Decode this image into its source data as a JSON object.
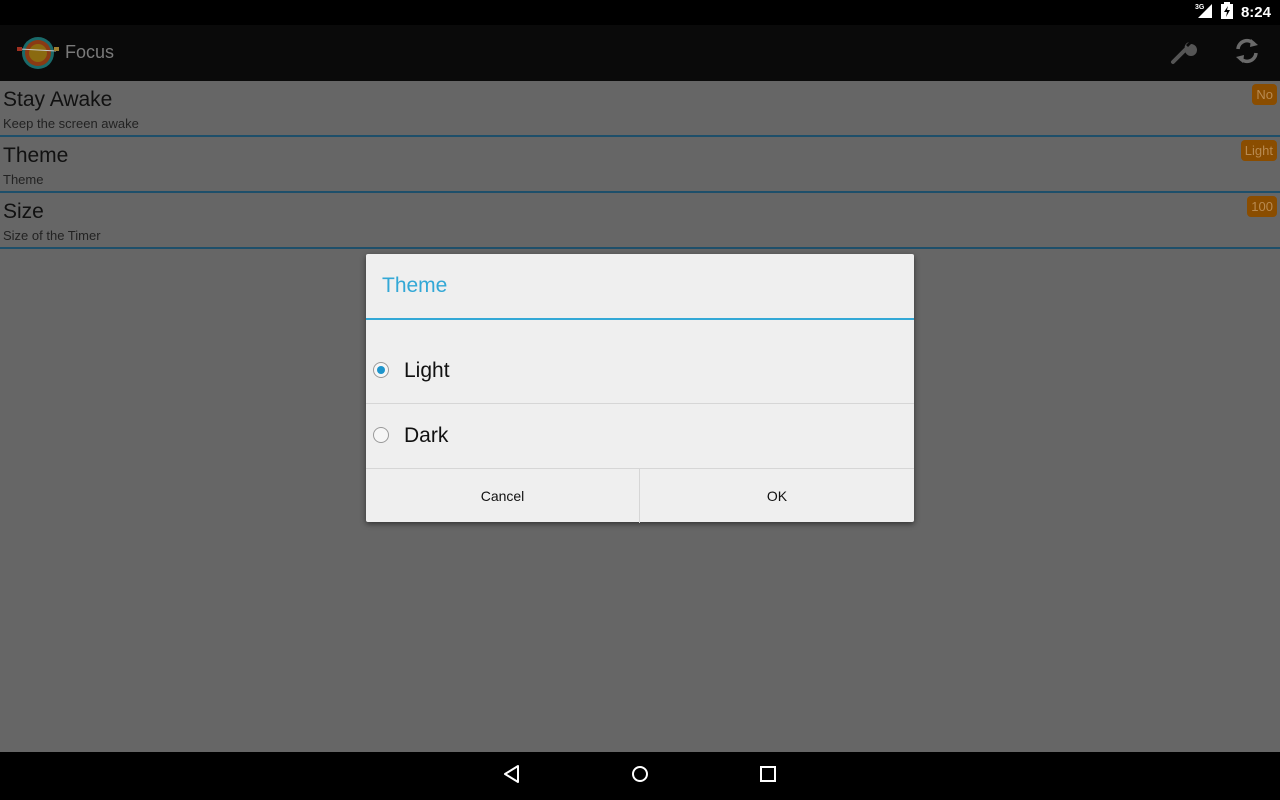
{
  "status_bar": {
    "network": "3G",
    "time": "8:24",
    "icons": [
      "signal-3g-icon",
      "battery-charging-icon"
    ]
  },
  "action_bar": {
    "title": "Focus",
    "icons": [
      "app-target-icon",
      "wrench-icon",
      "refresh-icon"
    ]
  },
  "preferences": [
    {
      "title": "Stay Awake",
      "summary": "Keep the screen awake",
      "value": "No"
    },
    {
      "title": "Theme",
      "summary": "Theme",
      "value": "Light"
    },
    {
      "title": "Size",
      "summary": "Size of the Timer",
      "value": "100"
    }
  ],
  "dialog": {
    "title": "Theme",
    "options": [
      {
        "label": "Light",
        "checked": true
      },
      {
        "label": "Dark",
        "checked": false
      }
    ],
    "cancel_label": "Cancel",
    "ok_label": "OK"
  },
  "nav_bar": {
    "icons": [
      "back-icon",
      "home-icon",
      "recents-icon"
    ]
  },
  "colors": {
    "accent": "#33a8d6",
    "badge": "#8a4d00",
    "divider": "#1e4f6a"
  }
}
